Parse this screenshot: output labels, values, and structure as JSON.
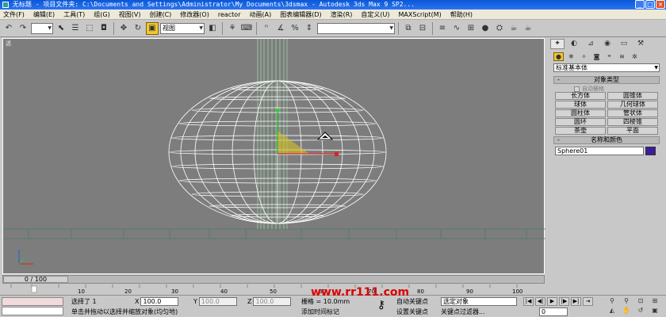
{
  "window": {
    "title": "无标题    - 项目文件夹: C:\\Documents and Settings\\Administrator\\My Documents\\3dsmax    - Autodesk 3ds Max 9 SP2...",
    "buttons": [
      "_",
      "□",
      "×"
    ]
  },
  "menu": [
    "文件(F)",
    "编辑(E)",
    "工具(T)",
    "组(G)",
    "视图(V)",
    "创建(C)",
    "修改器(O)",
    "reactor",
    "动画(A)",
    "图表编辑器(D)",
    "渲染(R)",
    "自定义(U)",
    "MAXScript(M)",
    "帮助(H)"
  ],
  "toolbar": {
    "selection_filter": "",
    "reference_coord": "视图",
    "named_selection": ""
  },
  "viewport": {
    "label": "透"
  },
  "command_panel": {
    "category": "标准基本体",
    "object_type_title": "对象类型",
    "auto_grid": "自动栅格",
    "objects": [
      "长方体",
      "圆锥体",
      "球体",
      "几何球体",
      "圆柱体",
      "管状体",
      "圆环",
      "四棱锥",
      "茶壶",
      "平面"
    ],
    "name_color_title": "名称和颜色",
    "object_name": "Sphere01",
    "object_color": "#3b1e9a"
  },
  "time": {
    "slider_label": "0 / 100",
    "ticks": [
      "0",
      "10",
      "20",
      "30",
      "40",
      "50",
      "60",
      "70",
      "80",
      "90",
      "100"
    ]
  },
  "status": {
    "selected": "选择了 1",
    "prompt": "单击并拖动以选择并缩放对象(均匀地)",
    "x_label": "X",
    "x_value": "100.0",
    "y_label": "Y",
    "y_value": "100.0",
    "z_label": "Z",
    "z_value": "100.0",
    "grid": "栅格 = 10.0mm",
    "add_time_tag": "添加时间标记",
    "auto_key": "自动关键点",
    "set_key": "设置关键点",
    "selection_set": "选定对象",
    "key_filters": "关键点过滤器...",
    "frame": "0"
  },
  "watermark": "www.rr111.com"
}
